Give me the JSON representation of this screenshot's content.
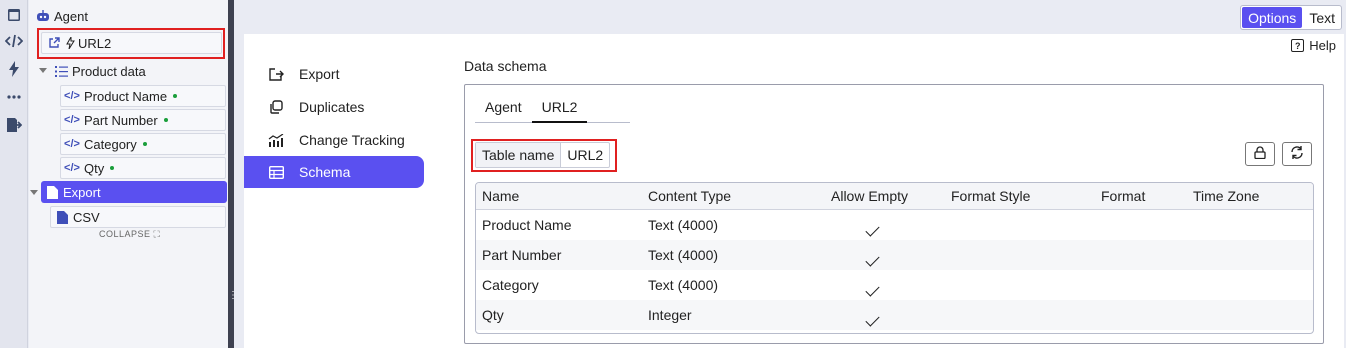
{
  "rail": {
    "icons": [
      "window-icon",
      "code-icon",
      "bolt-icon",
      "more-icon",
      "export-icon"
    ]
  },
  "tree": {
    "agent": "Agent",
    "url2": "URL2",
    "product_data": "Product data",
    "fields": [
      "Product Name",
      "Part Number",
      "Category",
      "Qty"
    ],
    "export": "Export",
    "csv": "CSV",
    "collapse": "COLLAPSE"
  },
  "toolbar": {
    "options": "Options",
    "text": "Text"
  },
  "help": "Help",
  "menu": {
    "items": [
      {
        "label": "Export",
        "icon": "export-icon"
      },
      {
        "label": "Duplicates",
        "icon": "duplicates-icon"
      },
      {
        "label": "Change Tracking",
        "icon": "change-tracking-icon"
      },
      {
        "label": "Schema",
        "icon": "schema-icon"
      }
    ],
    "active": "Schema"
  },
  "schema": {
    "title": "Data schema",
    "tabs": [
      "Agent",
      "URL2"
    ],
    "active_tab": "URL2",
    "table_name_label": "Table name",
    "table_name_value": "URL2",
    "columns": [
      "Name",
      "Content Type",
      "Allow Empty",
      "Format Style",
      "Format",
      "Time Zone"
    ],
    "rows": [
      {
        "name": "Product Name",
        "type": "Text (4000)",
        "allow_empty": true
      },
      {
        "name": "Part Number",
        "type": "Text (4000)",
        "allow_empty": true
      },
      {
        "name": "Category",
        "type": "Text (4000)",
        "allow_empty": true
      },
      {
        "name": "Qty",
        "type": "Integer",
        "allow_empty": true
      }
    ]
  },
  "colors": {
    "accent": "#5a50f0",
    "highlight": "#e02020",
    "status_dot": "#1a9e3a"
  }
}
